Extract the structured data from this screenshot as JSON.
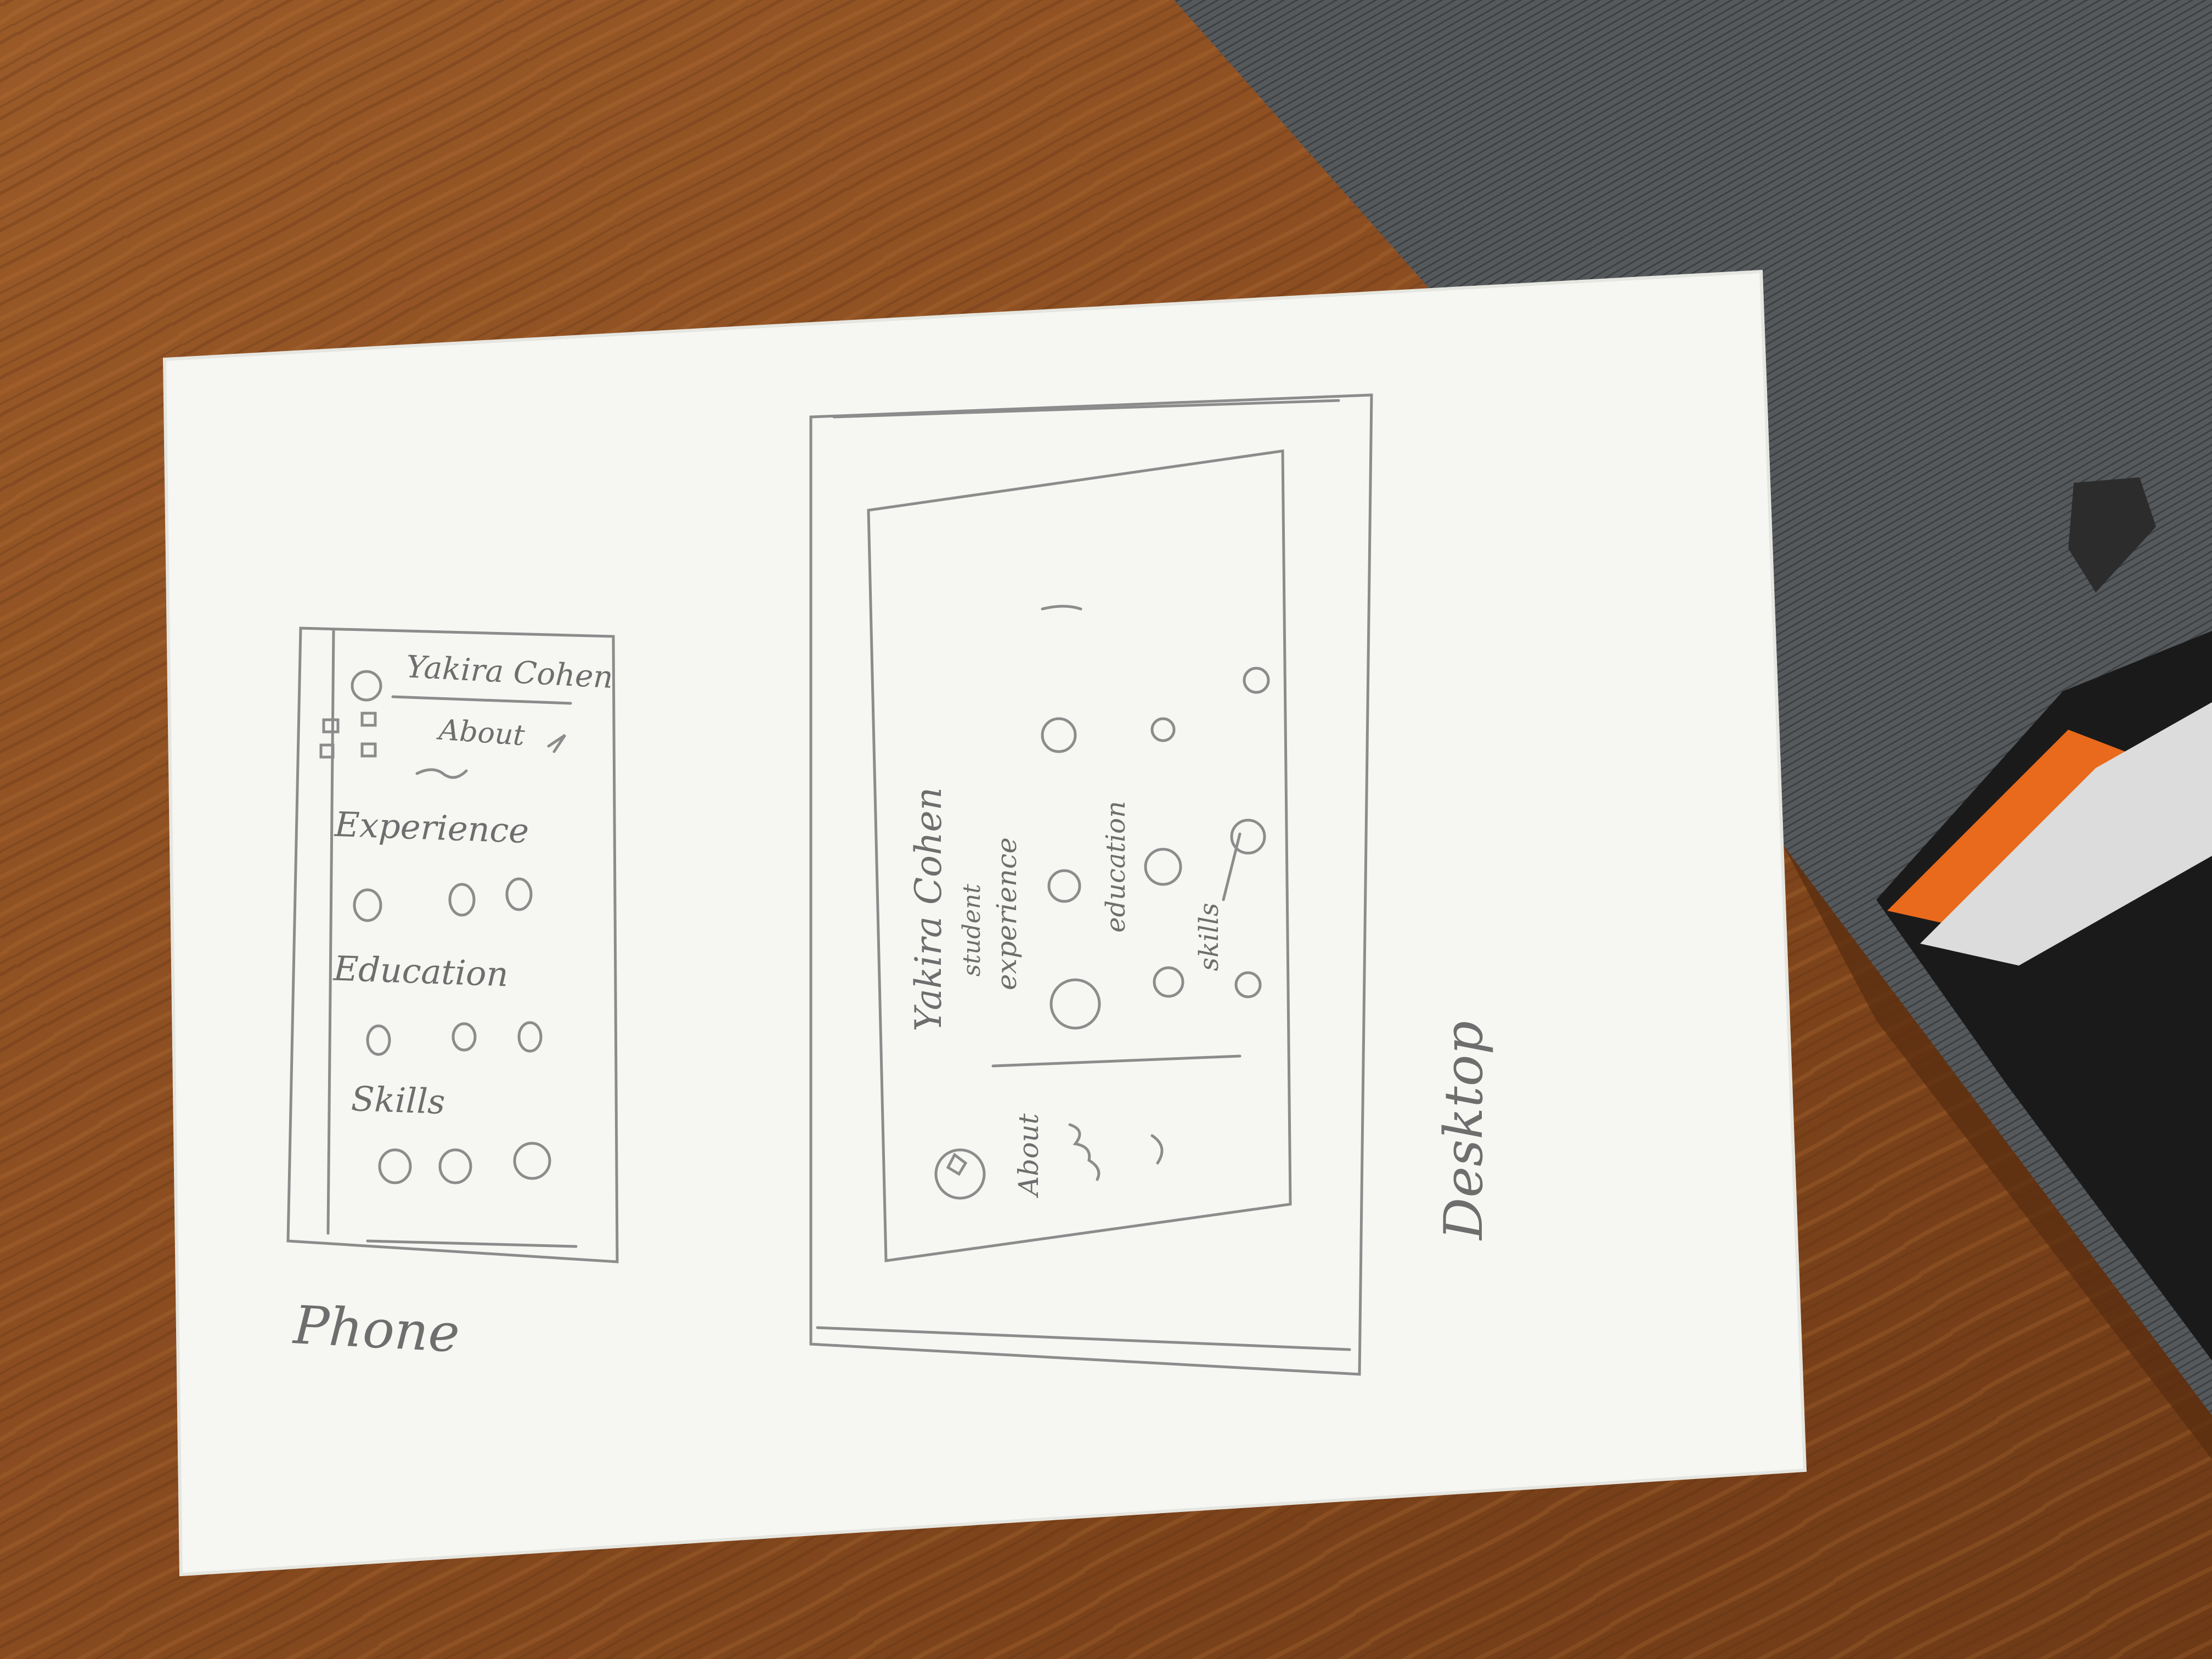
{
  "phone": {
    "name": "Yakira Cohen",
    "about": "About",
    "sections": [
      "Experience",
      "Education",
      "Skills"
    ],
    "caption": "Phone"
  },
  "desktop": {
    "name": "Yakira Cohen",
    "subtitle": "student",
    "sections": [
      "experience",
      "education",
      "skills"
    ],
    "about": "About",
    "caption": "Desktop"
  },
  "colors": {
    "wood": "#8a4e22",
    "carpet": "#4f5254",
    "paper": "#f7f7f5",
    "pencil": "#7a7a7a"
  }
}
